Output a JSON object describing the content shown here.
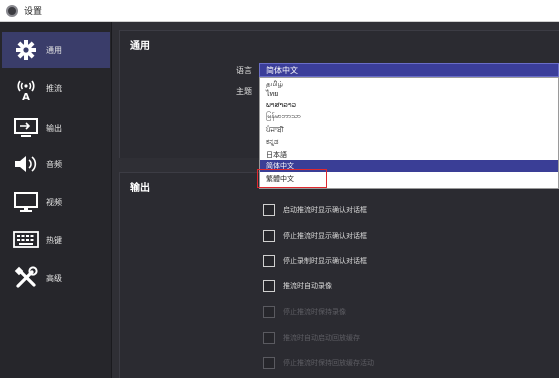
{
  "window": {
    "title": "设置"
  },
  "sidebar": {
    "items": [
      {
        "label": "通用",
        "icon": "gear-icon",
        "active": true
      },
      {
        "label": "推流",
        "icon": "broadcast-icon"
      },
      {
        "label": "输出",
        "icon": "output-monitor-icon"
      },
      {
        "label": "音频",
        "icon": "speaker-icon"
      },
      {
        "label": "视频",
        "icon": "monitor-icon"
      },
      {
        "label": "热键",
        "icon": "keyboard-icon"
      },
      {
        "label": "高级",
        "icon": "tools-icon"
      }
    ]
  },
  "general": {
    "title": "通用",
    "language_label": "语言",
    "theme_label": "主题",
    "language_value": "简体中文",
    "language_options": [
      "தமிழ்",
      "ไทย",
      "ພາສາລາວ",
      "မြန်မာဘာသာ",
      "ਪੰਜਾਬੀ",
      "ಕನ್ನಡ",
      "日本語",
      "简体中文",
      "繁體中文"
    ],
    "selected_option": "繁體中文"
  },
  "output": {
    "title": "输出",
    "checkboxes": [
      {
        "label": "启动推流时显示确认对话框",
        "disabled": false
      },
      {
        "label": "停止推流时显示确认对话框",
        "disabled": false
      },
      {
        "label": "停止录制时显示确认对话框",
        "disabled": false
      },
      {
        "label": "推流时自动录像",
        "disabled": false
      },
      {
        "label": "停止推流时保持录像",
        "disabled": true
      },
      {
        "label": "推流时自动启动回放缓存",
        "disabled": true
      },
      {
        "label": "停止推流时保持回放缓存活动",
        "disabled": true
      }
    ]
  },
  "colors": {
    "accent": "#3a3e96",
    "highlight_box": "#e0282e",
    "background": "#2f2f35"
  }
}
